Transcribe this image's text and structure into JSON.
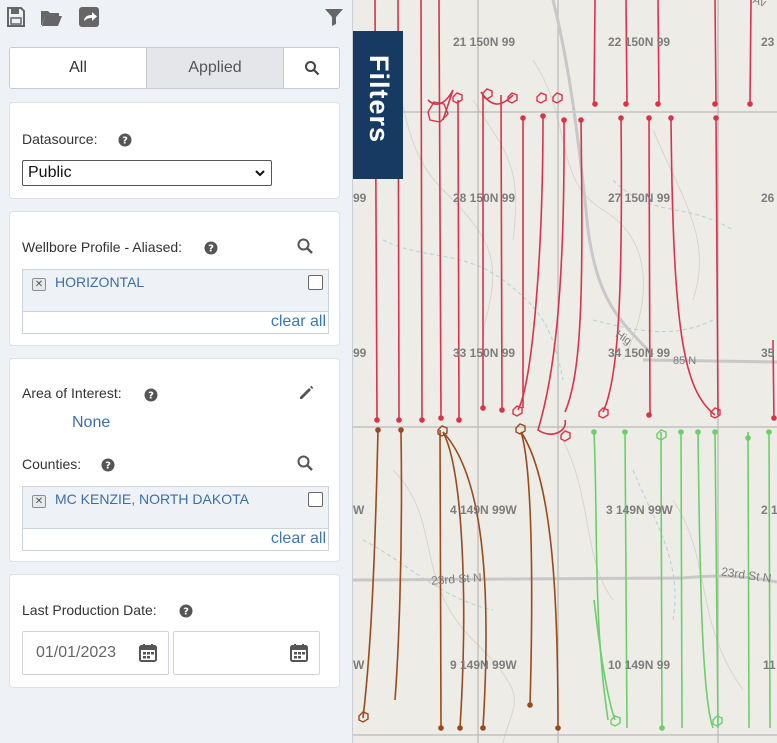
{
  "toolbar": {
    "icons": [
      "save-icon",
      "folder-open-icon",
      "share-icon",
      "filter-icon"
    ]
  },
  "tabs": {
    "all": "All",
    "applied": "Applied",
    "search_icon": "search-icon"
  },
  "datasource": {
    "label": "Datasource:",
    "value": "Public"
  },
  "wellbore_profile": {
    "label": "Wellbore Profile - Aliased:",
    "tag": "HORIZONTAL",
    "clear": "clear all"
  },
  "area_of_interest": {
    "label": "Area of Interest:",
    "value": "None"
  },
  "counties": {
    "label": "Counties:",
    "tag": "MC KENZIE, NORTH DAKOTA",
    "clear": "clear all"
  },
  "last_production": {
    "label": "Last Production Date:",
    "from": "01/01/2023",
    "to": ""
  },
  "filters_tab": "Filters",
  "map": {
    "sections": [
      "21 150N 99",
      "22 150N 99",
      "23",
      "28 150N 99",
      "27 150N 99",
      "26",
      "33 150N 99",
      "34 150N 99",
      "35",
      "99",
      "99",
      "4 149N 99W",
      "3 149N 99W",
      "2 1",
      "W",
      "9 149N 99W",
      "10 149N 99",
      "11",
      "W"
    ],
    "roads": [
      "23rd St N",
      "23rd St N",
      "Hig",
      "85 N",
      "Av"
    ],
    "colors": {
      "wells_red": "#d9334a",
      "wells_brown": "#9a4a1c",
      "wells_green": "#6ccf6c",
      "filters_tab": "#173a63"
    }
  }
}
